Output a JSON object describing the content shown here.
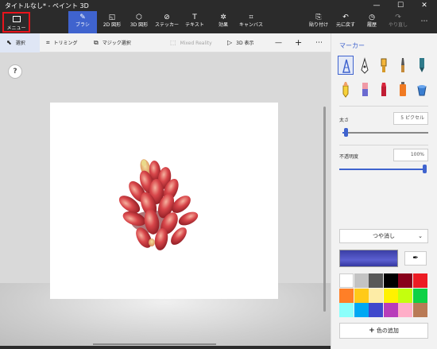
{
  "window": {
    "title": "タイトルなし* - ペイント 3D",
    "buttons": {
      "minimize": "—",
      "maximize": "☐",
      "close": "✕"
    }
  },
  "ribbon": {
    "menu_label": "メニュー",
    "tools": [
      {
        "label": "ブラシ",
        "icon": "✎",
        "icon_name": "brush-icon",
        "active": true
      },
      {
        "label": "2D 図形",
        "icon": "◱",
        "icon_name": "2d-shapes-icon"
      },
      {
        "label": "3D 図形",
        "icon": "⬡",
        "icon_name": "3d-shapes-icon"
      },
      {
        "label": "ステッカー",
        "icon": "⊘",
        "icon_name": "stickers-icon"
      },
      {
        "label": "テキスト",
        "icon": "T",
        "icon_name": "text-icon"
      },
      {
        "label": "効果",
        "icon": "✲",
        "icon_name": "effects-icon"
      },
      {
        "label": "キャンバス",
        "icon": "⌗",
        "icon_name": "canvas-icon"
      }
    ],
    "actions": [
      {
        "label": "貼り付け",
        "icon": "⎘",
        "icon_name": "paste-icon"
      },
      {
        "label": "元に戻す",
        "icon": "↶",
        "icon_name": "undo-icon"
      },
      {
        "label": "履歴",
        "icon": "◷",
        "icon_name": "history-icon"
      },
      {
        "label": "やり直し",
        "icon": "↷",
        "icon_name": "redo-icon",
        "disabled": true
      }
    ],
    "more": "⋯"
  },
  "subbar": {
    "select": "選択",
    "trim": "トリミング",
    "magic_select": "マジック選択",
    "mixed_reality": "Mixed Reality",
    "view_3d": "3D 表示",
    "zoom_out": "—",
    "zoom_in": "+",
    "more": "⋯"
  },
  "workspace": {
    "help": "?"
  },
  "panel": {
    "title": "マーカー",
    "thickness_label": "太さ",
    "thickness_value": "5 ピクセル",
    "thickness_level": 0.04,
    "opacity_label": "不透明度",
    "opacity_value": "100%",
    "opacity_level": 1.0,
    "finish": "つや消し",
    "add_color": "色の追加",
    "current_color": "#4a4ec0",
    "palette": [
      "#ffffff",
      "#c3c3c3",
      "#585858",
      "#000000",
      "#88001b",
      "#ec1c24",
      "#ff7f27",
      "#ffca18",
      "#fdeca6",
      "#fff200",
      "#c4ff0e",
      "#0ed145",
      "#8cfffb",
      "#00a8f3",
      "#3f48cc",
      "#b83dba",
      "#ffaec8",
      "#b97a56"
    ]
  }
}
